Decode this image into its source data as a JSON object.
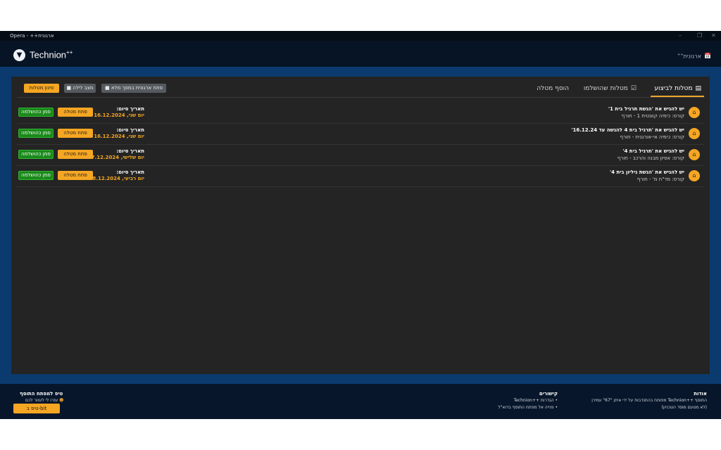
{
  "window": {
    "title": "Opera - ++ארגונית"
  },
  "app": {
    "logo_text": "Technion",
    "logo_sup": "++",
    "org_label": "ארגונית",
    "org_sup": "++"
  },
  "tabs": [
    {
      "label": "מטלות לביצוע",
      "active": true,
      "icon": "list-icon"
    },
    {
      "label": "מטלות שהושלמו",
      "active": false,
      "icon": "calendar-check-icon"
    },
    {
      "label": "הוסף מטלה",
      "active": false
    }
  ],
  "toolbar": {
    "open_fullscreen": "פתח ארגונית במסך מלא",
    "night_mode": "מצב לילה",
    "filter_tasks": "סינון מטלות"
  },
  "tasks": [
    {
      "title": "יש להגיש את 'הגשת תרגיל בית 1'",
      "course": "קורס: כימיה קוונטית 1 - חורף",
      "due_label": "תאריך סיום:",
      "due_date": "יום שני, 16.12.2024",
      "open_label": "פתח מטלה",
      "done_label": "סמן כהושלמה"
    },
    {
      "title": "יש להגיש את 'תרגיל בית 4 להגשה עד 16.12.24'",
      "course": "קורס: כימיה אי-אורגנית - חורף",
      "due_label": "תאריך סיום:",
      "due_date": "יום שני, 16.12.2024",
      "open_label": "פתח מטלה",
      "done_label": "סמן כהושלמה"
    },
    {
      "title": "יש להגיש את 'תרגיל בית 4'",
      "course": "קורס: אפיון מבנה והרכב - חורף",
      "due_label": "תאריך סיום:",
      "due_date": "יום שלישי, 17.12.2024",
      "open_label": "פתח מטלה",
      "done_label": "סמן כהושלמה"
    },
    {
      "title": "יש להגיש את 'הגשת גיליון בית 4'",
      "course": "קורס: מד\"ח מ' - חורף",
      "due_label": "תאריך סיום:",
      "due_date": "יום רביעי, 18.12.2024",
      "open_label": "פתח מטלה",
      "done_label": "סמן כהושלמה"
    }
  ],
  "footer": {
    "about": {
      "heading": "אודות",
      "line1": "התוסף ++Technion מפותח בהתנדבות על ידי איתן \"67\" עמירן",
      "line2": "(לא מטעם מוסד הטכניון)"
    },
    "links": {
      "heading": "קישורים",
      "items": [
        "הגדרות ++Technion",
        "פנייה אל מפתח התוסף בדוא\"ל"
      ]
    },
    "tip": {
      "heading": "טיפ למפתח התוסף",
      "line": "עזרו לי לעזור לכם",
      "button": "טיפ ב-bit"
    }
  }
}
